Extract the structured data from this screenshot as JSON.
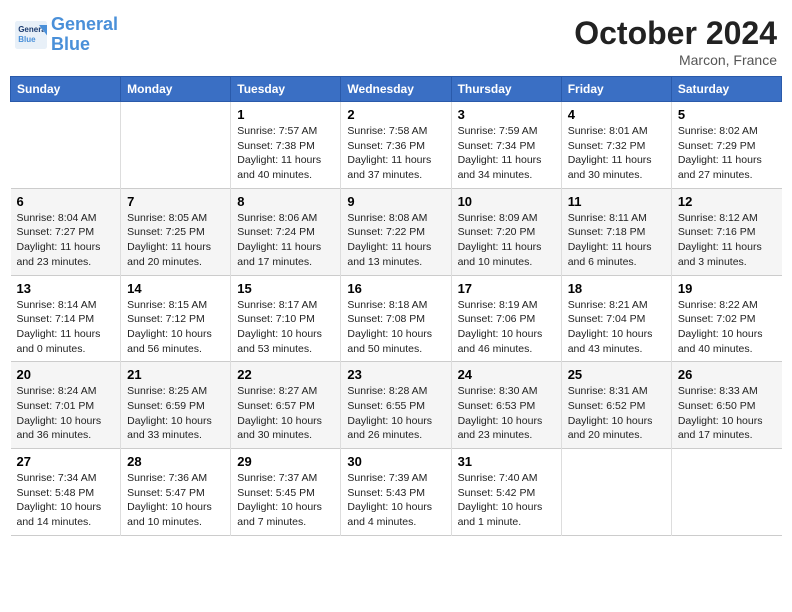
{
  "logo": {
    "line1": "General",
    "line2": "Blue"
  },
  "title": "October 2024",
  "location": "Marcon, France",
  "days_of_week": [
    "Sunday",
    "Monday",
    "Tuesday",
    "Wednesday",
    "Thursday",
    "Friday",
    "Saturday"
  ],
  "weeks": [
    [
      {
        "day": "",
        "info": ""
      },
      {
        "day": "",
        "info": ""
      },
      {
        "day": "1",
        "info": "Sunrise: 7:57 AM\nSunset: 7:38 PM\nDaylight: 11 hours and 40 minutes."
      },
      {
        "day": "2",
        "info": "Sunrise: 7:58 AM\nSunset: 7:36 PM\nDaylight: 11 hours and 37 minutes."
      },
      {
        "day": "3",
        "info": "Sunrise: 7:59 AM\nSunset: 7:34 PM\nDaylight: 11 hours and 34 minutes."
      },
      {
        "day": "4",
        "info": "Sunrise: 8:01 AM\nSunset: 7:32 PM\nDaylight: 11 hours and 30 minutes."
      },
      {
        "day": "5",
        "info": "Sunrise: 8:02 AM\nSunset: 7:29 PM\nDaylight: 11 hours and 27 minutes."
      }
    ],
    [
      {
        "day": "6",
        "info": "Sunrise: 8:04 AM\nSunset: 7:27 PM\nDaylight: 11 hours and 23 minutes."
      },
      {
        "day": "7",
        "info": "Sunrise: 8:05 AM\nSunset: 7:25 PM\nDaylight: 11 hours and 20 minutes."
      },
      {
        "day": "8",
        "info": "Sunrise: 8:06 AM\nSunset: 7:24 PM\nDaylight: 11 hours and 17 minutes."
      },
      {
        "day": "9",
        "info": "Sunrise: 8:08 AM\nSunset: 7:22 PM\nDaylight: 11 hours and 13 minutes."
      },
      {
        "day": "10",
        "info": "Sunrise: 8:09 AM\nSunset: 7:20 PM\nDaylight: 11 hours and 10 minutes."
      },
      {
        "day": "11",
        "info": "Sunrise: 8:11 AM\nSunset: 7:18 PM\nDaylight: 11 hours and 6 minutes."
      },
      {
        "day": "12",
        "info": "Sunrise: 8:12 AM\nSunset: 7:16 PM\nDaylight: 11 hours and 3 minutes."
      }
    ],
    [
      {
        "day": "13",
        "info": "Sunrise: 8:14 AM\nSunset: 7:14 PM\nDaylight: 11 hours and 0 minutes."
      },
      {
        "day": "14",
        "info": "Sunrise: 8:15 AM\nSunset: 7:12 PM\nDaylight: 10 hours and 56 minutes."
      },
      {
        "day": "15",
        "info": "Sunrise: 8:17 AM\nSunset: 7:10 PM\nDaylight: 10 hours and 53 minutes."
      },
      {
        "day": "16",
        "info": "Sunrise: 8:18 AM\nSunset: 7:08 PM\nDaylight: 10 hours and 50 minutes."
      },
      {
        "day": "17",
        "info": "Sunrise: 8:19 AM\nSunset: 7:06 PM\nDaylight: 10 hours and 46 minutes."
      },
      {
        "day": "18",
        "info": "Sunrise: 8:21 AM\nSunset: 7:04 PM\nDaylight: 10 hours and 43 minutes."
      },
      {
        "day": "19",
        "info": "Sunrise: 8:22 AM\nSunset: 7:02 PM\nDaylight: 10 hours and 40 minutes."
      }
    ],
    [
      {
        "day": "20",
        "info": "Sunrise: 8:24 AM\nSunset: 7:01 PM\nDaylight: 10 hours and 36 minutes."
      },
      {
        "day": "21",
        "info": "Sunrise: 8:25 AM\nSunset: 6:59 PM\nDaylight: 10 hours and 33 minutes."
      },
      {
        "day": "22",
        "info": "Sunrise: 8:27 AM\nSunset: 6:57 PM\nDaylight: 10 hours and 30 minutes."
      },
      {
        "day": "23",
        "info": "Sunrise: 8:28 AM\nSunset: 6:55 PM\nDaylight: 10 hours and 26 minutes."
      },
      {
        "day": "24",
        "info": "Sunrise: 8:30 AM\nSunset: 6:53 PM\nDaylight: 10 hours and 23 minutes."
      },
      {
        "day": "25",
        "info": "Sunrise: 8:31 AM\nSunset: 6:52 PM\nDaylight: 10 hours and 20 minutes."
      },
      {
        "day": "26",
        "info": "Sunrise: 8:33 AM\nSunset: 6:50 PM\nDaylight: 10 hours and 17 minutes."
      }
    ],
    [
      {
        "day": "27",
        "info": "Sunrise: 7:34 AM\nSunset: 5:48 PM\nDaylight: 10 hours and 14 minutes."
      },
      {
        "day": "28",
        "info": "Sunrise: 7:36 AM\nSunset: 5:47 PM\nDaylight: 10 hours and 10 minutes."
      },
      {
        "day": "29",
        "info": "Sunrise: 7:37 AM\nSunset: 5:45 PM\nDaylight: 10 hours and 7 minutes."
      },
      {
        "day": "30",
        "info": "Sunrise: 7:39 AM\nSunset: 5:43 PM\nDaylight: 10 hours and 4 minutes."
      },
      {
        "day": "31",
        "info": "Sunrise: 7:40 AM\nSunset: 5:42 PM\nDaylight: 10 hours and 1 minute."
      },
      {
        "day": "",
        "info": ""
      },
      {
        "day": "",
        "info": ""
      }
    ]
  ]
}
